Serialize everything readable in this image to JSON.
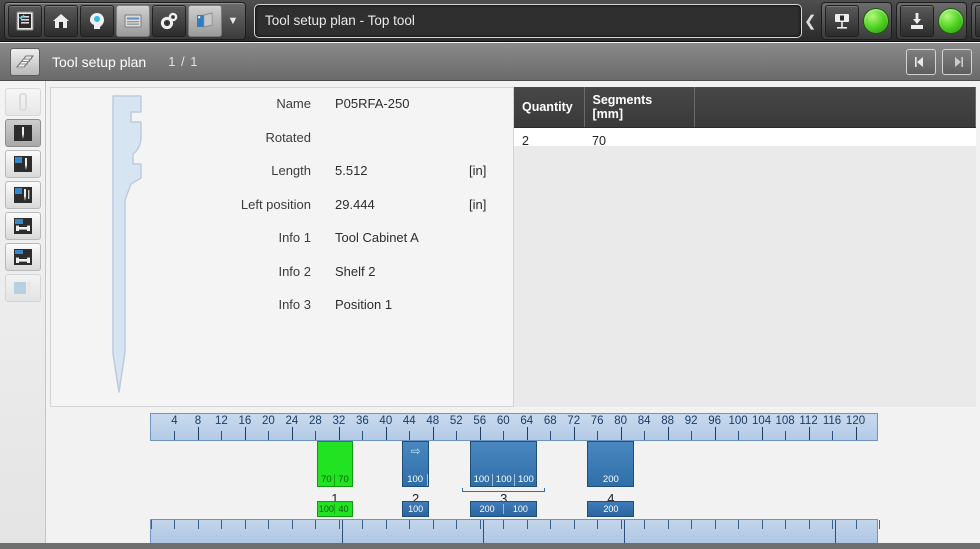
{
  "topbar": {
    "buttons": [
      {
        "name": "checklist-icon",
        "label": "Checklist"
      },
      {
        "name": "home-icon",
        "label": "Home"
      },
      {
        "name": "head-info-icon",
        "label": "Info"
      },
      {
        "name": "machine-icon",
        "label": "Machine"
      },
      {
        "name": "gears-icon",
        "label": "Settings"
      },
      {
        "name": "modules-icon",
        "label": "Modules"
      }
    ],
    "dropdown_icon": "chevron-down-icon",
    "title": "Tool setup plan - Top tool",
    "collapse_icon": "chevron-left-icon",
    "status_buttons": [
      {
        "name": "press-tool-icon",
        "led": "green"
      },
      {
        "name": "tool-load-icon",
        "led": "green"
      },
      {
        "name": "machine-status-icon",
        "led": "green"
      }
    ],
    "led_color": "#57d827"
  },
  "pagebar": {
    "icon": "tool-setup-icon",
    "title": "Tool setup plan",
    "page_current": "1",
    "page_separator": "/",
    "page_total": "1",
    "prev_label": "prev-page-icon",
    "next_label": "next-page-icon"
  },
  "rail": {
    "items": [
      {
        "name": "sidebar-item-tool-outline",
        "state": "dim"
      },
      {
        "name": "sidebar-item-single-tool",
        "state": "on"
      },
      {
        "name": "sidebar-item-tool-left",
        "state": "normal"
      },
      {
        "name": "sidebar-item-tool-right",
        "state": "normal"
      },
      {
        "name": "sidebar-item-bar-top",
        "state": "normal"
      },
      {
        "name": "sidebar-item-bar-bottom",
        "state": "normal"
      },
      {
        "name": "sidebar-item-overview",
        "state": "dim"
      }
    ]
  },
  "detail": {
    "graphic_name": "tool-profile-graphic",
    "properties": [
      {
        "label": "Name",
        "value": "P05RFA-250",
        "unit": ""
      },
      {
        "label": "Rotated",
        "value": "",
        "unit": ""
      },
      {
        "label": "Length",
        "value": "5.512",
        "unit": "[in]"
      },
      {
        "label": "Left position",
        "value": "29.444",
        "unit": "[in]"
      },
      {
        "label": "Info 1",
        "value": "Tool Cabinet A",
        "unit": ""
      },
      {
        "label": "Info 2",
        "value": "Shelf 2",
        "unit": ""
      },
      {
        "label": "Info 3",
        "value": "Position 1",
        "unit": ""
      }
    ]
  },
  "segments_table": {
    "columns": [
      "Quantity",
      "Segments [mm]",
      ""
    ],
    "rows": [
      [
        "2",
        "70",
        ""
      ]
    ]
  },
  "chart_data": {
    "type": "bar",
    "title": "Tool setup plan",
    "xlabel": "",
    "ylabel": "",
    "axis_unit": "",
    "xlim": [
      0,
      124
    ],
    "tick_labels": [
      4,
      8,
      12,
      16,
      20,
      24,
      28,
      32,
      36,
      40,
      44,
      48,
      52,
      56,
      60,
      64,
      68,
      72,
      76,
      80,
      84,
      88,
      92,
      96,
      100,
      104,
      108,
      112,
      116,
      120
    ],
    "tick_step": 4,
    "grid": false,
    "legend": "none",
    "groups": [
      {
        "number": "1",
        "color": "#22e322",
        "start": 28.5,
        "end": 34.5,
        "segments": [
          "70",
          "70"
        ],
        "arrow": false
      },
      {
        "number": "2",
        "color": "#2f6fa8",
        "start": 43.0,
        "end": 47.5,
        "segments": [
          "100"
        ],
        "arrow": true
      },
      {
        "number": "3",
        "color": "#2f6fa8",
        "start": 54.5,
        "end": 66.0,
        "segments": [
          "100",
          "100",
          "100"
        ],
        "arrow": false,
        "bracket": true
      },
      {
        "number": "4",
        "color": "#2f6fa8",
        "start": 74.5,
        "end": 82.5,
        "segments": [
          "200"
        ],
        "arrow": false
      }
    ],
    "overview": {
      "groups": [
        {
          "number": "1",
          "color": "#22e322",
          "start": 28.5,
          "end": 34.5,
          "segments": [
            "100",
            "40"
          ]
        },
        {
          "number": "2",
          "color": "#2f6fa8",
          "start": 43.0,
          "end": 47.5,
          "segments": [
            "100"
          ]
        },
        {
          "number": "3",
          "color": "#2f6fa8",
          "start": 54.5,
          "end": 66.0,
          "segments": [
            "200",
            "100"
          ]
        },
        {
          "number": "4",
          "color": "#2f6fa8",
          "start": 74.5,
          "end": 82.5,
          "segments": [
            "200"
          ]
        }
      ],
      "dividers": [
        32.5,
        56.5,
        80.5,
        116.5
      ]
    }
  },
  "colors": {
    "accent_blue": "#2f6fa8",
    "highlight_green": "#22e322",
    "ruler_blue": "#b3cae6",
    "header_dark": "#3a3a3a"
  }
}
